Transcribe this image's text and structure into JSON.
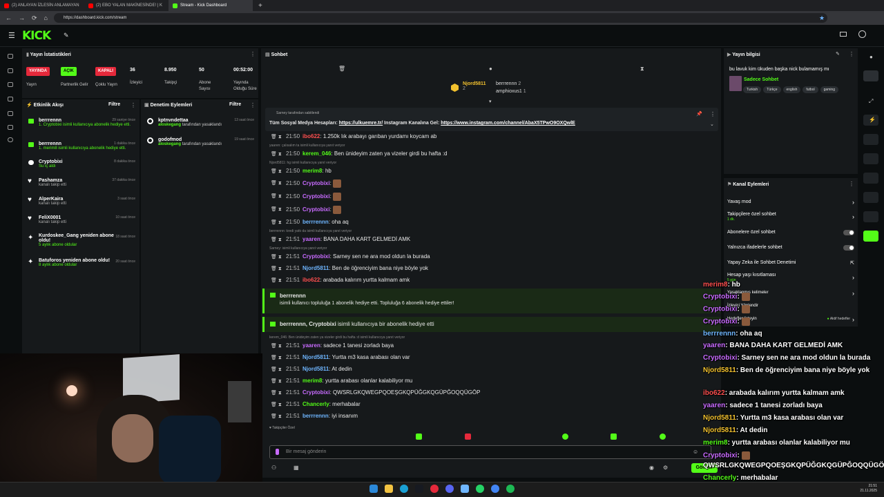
{
  "browser": {
    "tabs": [
      {
        "label": "(2) ANLAYAN İZLESİN ANLAMAYAN",
        "color": "#ff0000"
      },
      {
        "label": "(2) EBO YALAN MAKİNESİNDE! | K",
        "color": "#ff0000"
      },
      {
        "label": "Stream - Kick Dashboard",
        "color": "#53fc18"
      }
    ],
    "url": "https://dashboard.kick.com/stream"
  },
  "logo": "KICK",
  "stats": {
    "title": "Yayın İstatistikleri",
    "items": [
      {
        "badge": "YAYINDA",
        "badge_color": "#e5293b",
        "label": "Yayın"
      },
      {
        "badge": "AÇIK",
        "badge_color": "#53fc18",
        "label": "Partnerlik Gelir"
      },
      {
        "badge": "KAPALI",
        "badge_color": "#e5293b",
        "label": "Çoklu Yayın"
      },
      {
        "value": "36",
        "label": "İzleyici"
      },
      {
        "value": "8.950",
        "label": "Takipçi"
      },
      {
        "value": "50",
        "label": "Abone Sayısı"
      },
      {
        "value": "00:52:00",
        "label": "Yayında Olduğu Süre"
      }
    ]
  },
  "activity": {
    "title": "Etkinlik Akışı",
    "filter": "Filtre",
    "items": [
      {
        "name": "berrrennn",
        "sub": "1. Cryptobixi isimli kullanıcıya abonelik hediye etti.",
        "time": "29 saniye önce"
      },
      {
        "name": "berrrennn",
        "sub": "1. merim8 isimli kullanıcıya abonelik hediye etti.",
        "time": "1 dakika önce"
      },
      {
        "name": "Cryptobixi",
        "sub": "Su iç aldı",
        "time": "8 dakika önce"
      },
      {
        "name": "Pashamza",
        "sub": "kanalı takip etti",
        "time": "37 dakika önce"
      },
      {
        "name": "AlperKaira",
        "sub": "kanalı takip etti",
        "time": "3 saat önce"
      },
      {
        "name": "FeliX0001",
        "sub": "kanalı takip etti",
        "time": "10 saat önce"
      },
      {
        "name": "Kurdoskee_Gang yeniden abone oldu!",
        "sub": "5 aylık abone oldular",
        "time": "18 saat önce"
      },
      {
        "name": "Batuforos yeniden abone oldu!",
        "sub": "8 aylık abone oldular",
        "time": "20 saat önce"
      }
    ]
  },
  "moderation": {
    "title": "Denetim Eylemleri",
    "filter": "Filtre",
    "items": [
      {
        "name": "kptnvndettaa",
        "sub": "aloskegang tarafından yasaklandı",
        "time": "13 saat önce"
      },
      {
        "name": "godofmod",
        "sub": "aloskegang tarafından yasaklandı",
        "time": "19 saat önce"
      }
    ]
  },
  "chat": {
    "title": "Sohbet",
    "top_users": {
      "first": "Njord5811",
      "first_count": "2",
      "second": "berrrennn",
      "second_count": "2",
      "third": "amphioxus1",
      "third_count": "1"
    },
    "pinned_by": "Sarney tarafından sabitlendi",
    "pinned_text": "Tüm Sosyal Medya Hesapları:",
    "pinned_link1": "https://ulkuemre.tr/",
    "pinned_mid": "Instagram Kanalına Gel:",
    "pinned_link2": "https://www.instagram.com/channel/AbaX5TPwO9OXQwlE",
    "messages": [
      {
        "reply": "",
        "time": "21:50",
        "user": "ibo622",
        "ucls": "r",
        "text": "1.250k lık arabayı garıban yurdamı koycam ab"
      },
      {
        "reply": "yaaren: çalısalım ta isimli kullanıcıya yanıt veriyor",
        "time": "21:50",
        "user": "kerem_046",
        "ucls": "g",
        "text": "Ben ünideyim zaten ya vizeler girdi bu hafta :d"
      },
      {
        "reply": "Njord5811: hg isimli kullanıcıya yanıt veriyor",
        "time": "21:50",
        "user": "merim8",
        "ucls": "g",
        "text": "hb"
      },
      {
        "reply": "",
        "time": "21:50",
        "user": "Cryptobixi",
        "ucls": "p",
        "text": ""
      },
      {
        "reply": "",
        "time": "21:50",
        "user": "Cryptobixi",
        "ucls": "p",
        "text": ""
      },
      {
        "reply": "",
        "time": "21:50",
        "user": "Cryptobixi",
        "ucls": "p",
        "text": ""
      },
      {
        "reply": "",
        "time": "21:50",
        "user": "berrrennn",
        "ucls": "b",
        "text": "oha aq"
      },
      {
        "reply": "berrrennn: kredi yattı da isimli kullanıcıya yanıt veriyor",
        "time": "21:51",
        "user": "yaaren",
        "ucls": "p",
        "text": "BANA DAHA KART GELMEDİ AMK"
      },
      {
        "reply": "Sarney: isimli kullanıcıya yanıt veriyor",
        "time": "21:51",
        "user": "Cryptobixi",
        "ucls": "p",
        "text": "Sarney sen ne ara mod oldun la burada"
      },
      {
        "reply": "",
        "time": "21:51",
        "user": "Njord5811",
        "ucls": "b",
        "text": "Ben de öğrenciyim bana niye böyle yok"
      },
      {
        "reply": "",
        "time": "21:51",
        "user": "ibo622",
        "ucls": "r",
        "text": "arabada kalırım yurtta kalmam amk"
      }
    ],
    "gift1_user": "berrrennn",
    "gift1_text": "isimli kullanıcı topluluğa 1 abonelik hediye etti. Topluluğa 6 abonelik hediye ettiler!",
    "gift2_user": "berrrennn, Cryptobixi",
    "gift2_text": "isimli kullanıcıya bir abonelik hediye etti",
    "messages2": [
      {
        "reply": "kerem_046: Ben ünideyim zaten ya vizeler girdi bu hafta :d isimli kullanıcıya yanıt veriyor",
        "time": "21:51",
        "user": "yaaren",
        "ucls": "p",
        "text": "sadece 1 tanesi zorladı baya"
      },
      {
        "reply": "",
        "time": "21:51",
        "user": "Njord5811",
        "ucls": "b",
        "text": "Yurtta m3 kasa arabası olan var"
      },
      {
        "reply": "",
        "time": "21:51",
        "user": "Njord5811",
        "ucls": "b",
        "text": "At dedin"
      },
      {
        "reply": "",
        "time": "21:51",
        "user": "merim8",
        "ucls": "g",
        "text": "yurtta arabası olanlar kalabiliyor mu"
      },
      {
        "reply": "",
        "time": "21:51",
        "user": "Cryptobixi",
        "ucls": "p",
        "text": "QWSRLGKQWEGPQOEŞGKQPÜĞGKQGÜPĞOQQÜGÖP"
      },
      {
        "reply": "",
        "time": "21:51",
        "user": "Chancerly",
        "ucls": "g",
        "text": "merhabalar"
      },
      {
        "reply": "",
        "time": "21:51",
        "user": "berrrennn",
        "ucls": "b",
        "text": "iyi insanım"
      }
    ],
    "followers_only": "Takipçiler Özel",
    "placeholder": "Bir mesaj gönderin",
    "send": "Gönder"
  },
  "stream_info": {
    "title": "Yayın bilgisi",
    "stream_title": "bu lavuk kim ükuden başka nick bulamamış mı",
    "category": "Sadece Sohbet",
    "tags": [
      "Turkish",
      "Türkçe",
      "english",
      "futbol",
      "gaming"
    ]
  },
  "channel_actions": {
    "title": "Kanal Eylemleri",
    "items": [
      "Yavaş mod",
      "Takipçilere özel sohbet",
      "Abonelere özel sohbet",
      "Yalnızca ifadelerle sohbet",
      "Yapay Zeka ile Sohbet Denetimi",
      "Hesap yaşı kısıtlaması",
      "Yasaklanmış kelimeler",
      "İzleyici Yönlendir",
      "Hedefler listeyin"
    ],
    "slow_sub": "1 dk.",
    "age_sub": "5 gün",
    "goals_status": "Aktif hedefler"
  },
  "overlay": [
    {
      "user": "merim8",
      "ucls": "r",
      "text": ": hb"
    },
    {
      "user": "Cryptobixi",
      "ucls": "p",
      "text": ":"
    },
    {
      "user": "Cryptobixi",
      "ucls": "p",
      "text": ":"
    },
    {
      "user": "Cryptobixi",
      "ucls": "p",
      "text": ":"
    },
    {
      "user": "berrrennn",
      "ucls": "b",
      "text": ": oha aq"
    },
    {
      "user": "yaaren",
      "ucls": "p",
      "text": ": BANA DAHA KART GELMEDİ AMK"
    },
    {
      "user": "Cryptobixi",
      "ucls": "p",
      "text": ": Sarney sen ne ara mod oldun la burada"
    },
    {
      "user": "Njord5811",
      "ucls": "y",
      "text": ": Ben de öğrenciyim bana niye böyle yok"
    },
    {
      "user": "ibo622",
      "ucls": "r",
      "text": ": arabada kalırım yurtta kalmam amk"
    },
    {
      "user": "yaaren",
      "ucls": "p",
      "text": ": sadece 1 tanesi zorladı baya"
    },
    {
      "user": "Njord5811",
      "ucls": "y",
      "text": ": Yurtta m3 kasa arabası olan var"
    },
    {
      "user": "Njord5811",
      "ucls": "y",
      "text": ": At dedin"
    },
    {
      "user": "merim8",
      "ucls": "g",
      "text": ": yurtta arabası olanlar kalabiliyor mu"
    },
    {
      "user": "Cryptobixi",
      "ucls": "p",
      "text": ":"
    },
    {
      "user": "",
      "ucls": "",
      "text": "QWSRLGKQWEGPQOEŞGKQPÜĞGKQGÜPĞOQQÜGÖP"
    },
    {
      "user": "Chancerly",
      "ucls": "g",
      "text": ": merhabalar"
    },
    {
      "user": "berrrennn",
      "ucls": "b",
      "text": ": iyi insanım"
    }
  ],
  "clock": {
    "time": "21:51",
    "date": "21.11.2025"
  }
}
